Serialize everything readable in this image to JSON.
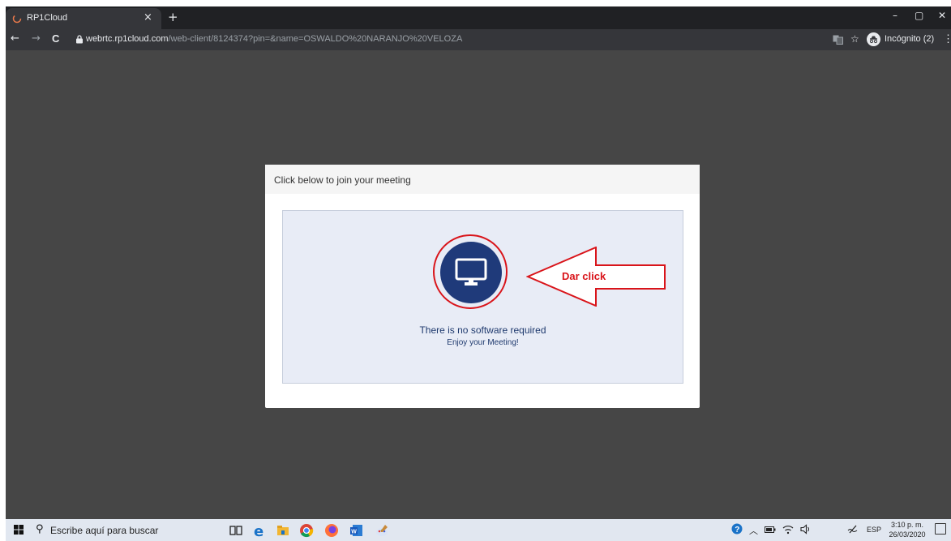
{
  "browser": {
    "tab_title": "RP1Cloud",
    "tab_close": "×",
    "new_tab": "+",
    "window_controls": [
      "–",
      "▢",
      "✕"
    ],
    "nav": {
      "back": "←",
      "forward": "→",
      "reload": "C"
    },
    "url_host": "webrtc.rp1cloud.com",
    "url_path": "/web-client/8124374?pin=&name=OSWALDO%20NARANJO%20VELOZA",
    "incognito_label": "Incógnito (2)",
    "star": "☆",
    "menu": "⋮"
  },
  "modal": {
    "title": "Click below to join your meeting",
    "annotation": "Dar click",
    "message": "There is no software required",
    "submessage": "Enjoy your Meeting!"
  },
  "colors": {
    "join_button": "#1f3a7a",
    "annotation_red": "#d9141a",
    "panel_bg": "#e8ecf6",
    "page_bg": "#464646"
  },
  "taskbar": {
    "search_placeholder": "Escribe aquí para buscar",
    "apps": [
      "task-view-icon",
      "edge-icon",
      "file-explorer-icon",
      "chrome-icon",
      "firefox-icon",
      "word-icon",
      "paint-icon"
    ],
    "language": "ESP",
    "time": "3:10 p. m.",
    "date": "26/03/2020"
  }
}
